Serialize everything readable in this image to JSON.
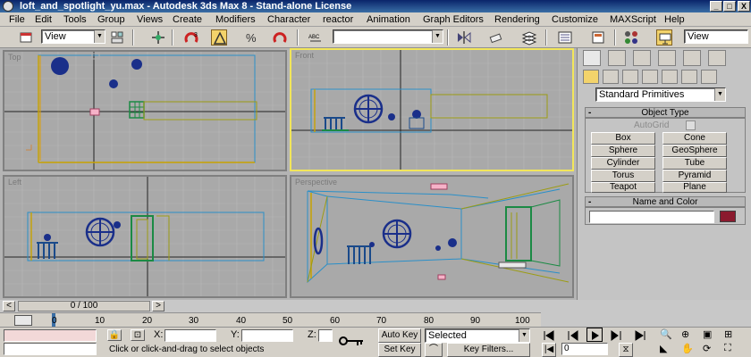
{
  "window": {
    "title": "loft_and_spotlight_yu.max - Autodesk 3ds Max 8  - Stand-alone License",
    "min_label": "_",
    "max_label": "□",
    "close_label": "X"
  },
  "menu": [
    "File",
    "Edit",
    "Tools",
    "Group",
    "Views",
    "Create",
    "Modifiers",
    "Character",
    "reactor",
    "Animation",
    "Graph Editors",
    "Rendering",
    "Customize",
    "MAXScript",
    "Help"
  ],
  "toolbar": {
    "ref_coord": "View",
    "named_selection": "",
    "render_view": "View"
  },
  "command_panel": {
    "category": "Standard Primitives",
    "object_type_title": "Object Type",
    "autogrid_label": "AutoGrid",
    "buttons": [
      "Box",
      "Cone",
      "Sphere",
      "GeoSphere",
      "Cylinder",
      "Tube",
      "Torus",
      "Pyramid",
      "Teapot",
      "Plane"
    ],
    "name_color_title": "Name and Color",
    "name_value": "",
    "object_color": "#8b1a2e",
    "rollout_marker": "-"
  },
  "time": {
    "frame_display": "0 / 100",
    "prev_label": "<",
    "next_label": ">",
    "ruler": [
      "0",
      "10",
      "20",
      "30",
      "40",
      "50",
      "60",
      "70",
      "80",
      "90",
      "100"
    ]
  },
  "status": {
    "x_label": "X:",
    "y_label": "Y:",
    "z_label": "Z:",
    "x_value": "",
    "y_value": "",
    "z_value": "",
    "prompt": "Click or click-and-drag to select objects",
    "auto_key": "Auto Key",
    "set_key": "Set Key",
    "key_mode": "Selected",
    "key_filters": "Key Filters...",
    "current_frame": "0"
  },
  "colors": {
    "active_viewport_border": "#f2e65a",
    "viewport_bg": "#a9a9a9"
  }
}
